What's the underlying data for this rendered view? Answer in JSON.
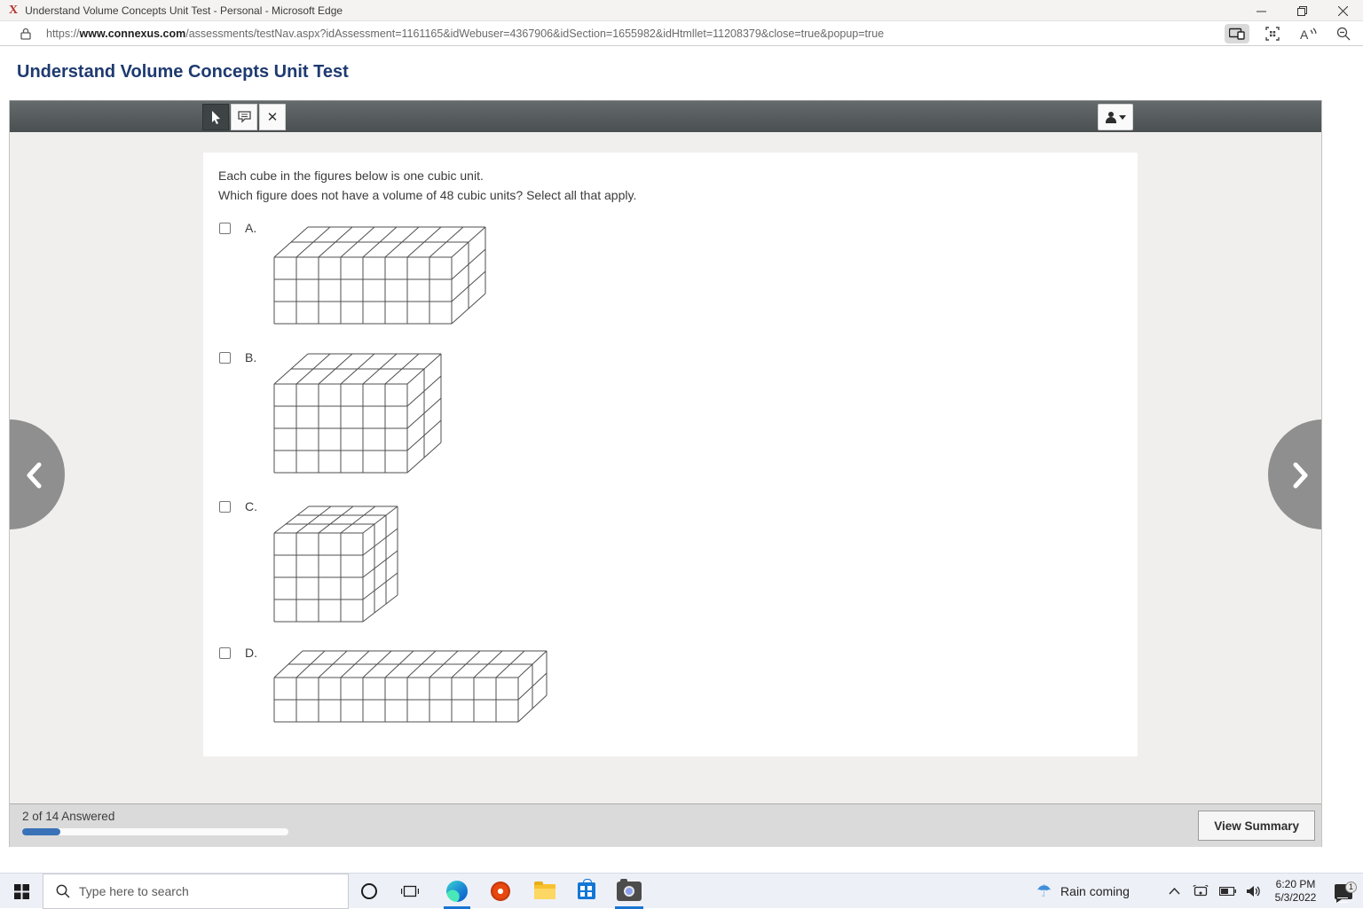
{
  "browser": {
    "tab_title": "Understand Volume Concepts Unit Test - Personal - Microsoft Edge",
    "favicon_glyph": "X",
    "url_scheme": "https://",
    "url_host": "www.connexus.com",
    "url_path": "/assessments/testNav.aspx?idAssessment=1161165&idWebuser=4367906&idSection=1655982&idHtmllet=11208379&close=true&popup=true"
  },
  "page": {
    "title": "Understand Volume Concepts Unit Test"
  },
  "toolbar": {
    "close_glyph": "✕"
  },
  "question": {
    "line1": "Each cube in the figures below is one cubic unit.",
    "line2": "Which figure does not have a volume of 48 cubic units? Select all that apply."
  },
  "options": [
    {
      "label": "A.",
      "checked": false
    },
    {
      "label": "B.",
      "checked": false
    },
    {
      "label": "C.",
      "checked": false
    },
    {
      "label": "D.",
      "checked": false
    }
  ],
  "chart_data": {
    "type": "table",
    "title": "Cuboid figures built from unit cubes",
    "figures": [
      {
        "option": "A",
        "cols": 8,
        "rows": 3,
        "depth": 2,
        "volume": 48
      },
      {
        "option": "B",
        "cols": 6,
        "rows": 4,
        "depth": 2,
        "volume": 48
      },
      {
        "option": "C",
        "cols": 4,
        "rows": 4,
        "depth": 3,
        "volume": 48
      },
      {
        "option": "D",
        "cols": 11,
        "rows": 2,
        "depth": 2,
        "volume": 44
      }
    ]
  },
  "footer": {
    "answered_text": "2 of 14 Answered",
    "answered": 2,
    "total": 14,
    "view_summary_label": "View Summary"
  },
  "taskbar": {
    "search_placeholder": "Type here to search",
    "weather_icon_glyph": "☂",
    "weather_label": "Rain coming",
    "time": "6:20 PM",
    "date": "5/3/2022",
    "notification_count": "1"
  }
}
